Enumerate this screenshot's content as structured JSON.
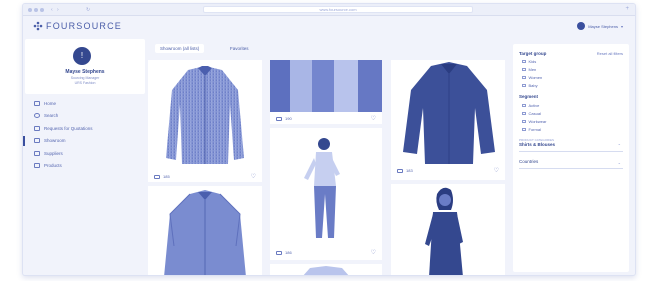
{
  "browser": {
    "nav_back": "‹",
    "nav_forward": "›",
    "nav_reload": "↻",
    "url": "www.foursource.com",
    "plus": "+"
  },
  "brand": {
    "name": "FOURSOURCE"
  },
  "user": {
    "top_name": "Mayse Stephens",
    "chevron": "▾"
  },
  "profile": {
    "initial": "!",
    "name": "Mayse Stephens",
    "role": "Sourcing Manager",
    "company": "URS Fashion"
  },
  "nav": {
    "items": [
      {
        "label": "Home"
      },
      {
        "label": "Search"
      },
      {
        "label": "Requests for Quotations"
      },
      {
        "label": "Showroom"
      },
      {
        "label": "Suppliers"
      },
      {
        "label": "Products"
      }
    ]
  },
  "tabs": [
    {
      "label": "Showroom (all lists)"
    },
    {
      "label": "Favorites"
    }
  ],
  "cards": [
    {
      "count": "185"
    },
    {
      "count": "190"
    },
    {
      "count": "186"
    },
    {
      "count": "183"
    }
  ],
  "filters": {
    "target_group_title": "Target group",
    "reset": "Reset all filters",
    "target_groups": [
      "Kids",
      "Men",
      "Women",
      "Baby"
    ],
    "segment_title": "Segment",
    "segments": [
      "Active",
      "Casual",
      "Workwear",
      "Formal"
    ],
    "category_small": "PRODUCT CATEGORIES",
    "category": "Shirts & Blouses",
    "countries": "Countries",
    "chevron": "⌄"
  },
  "colors": {
    "accent": "#34488f",
    "background": "#f1f3fb"
  }
}
